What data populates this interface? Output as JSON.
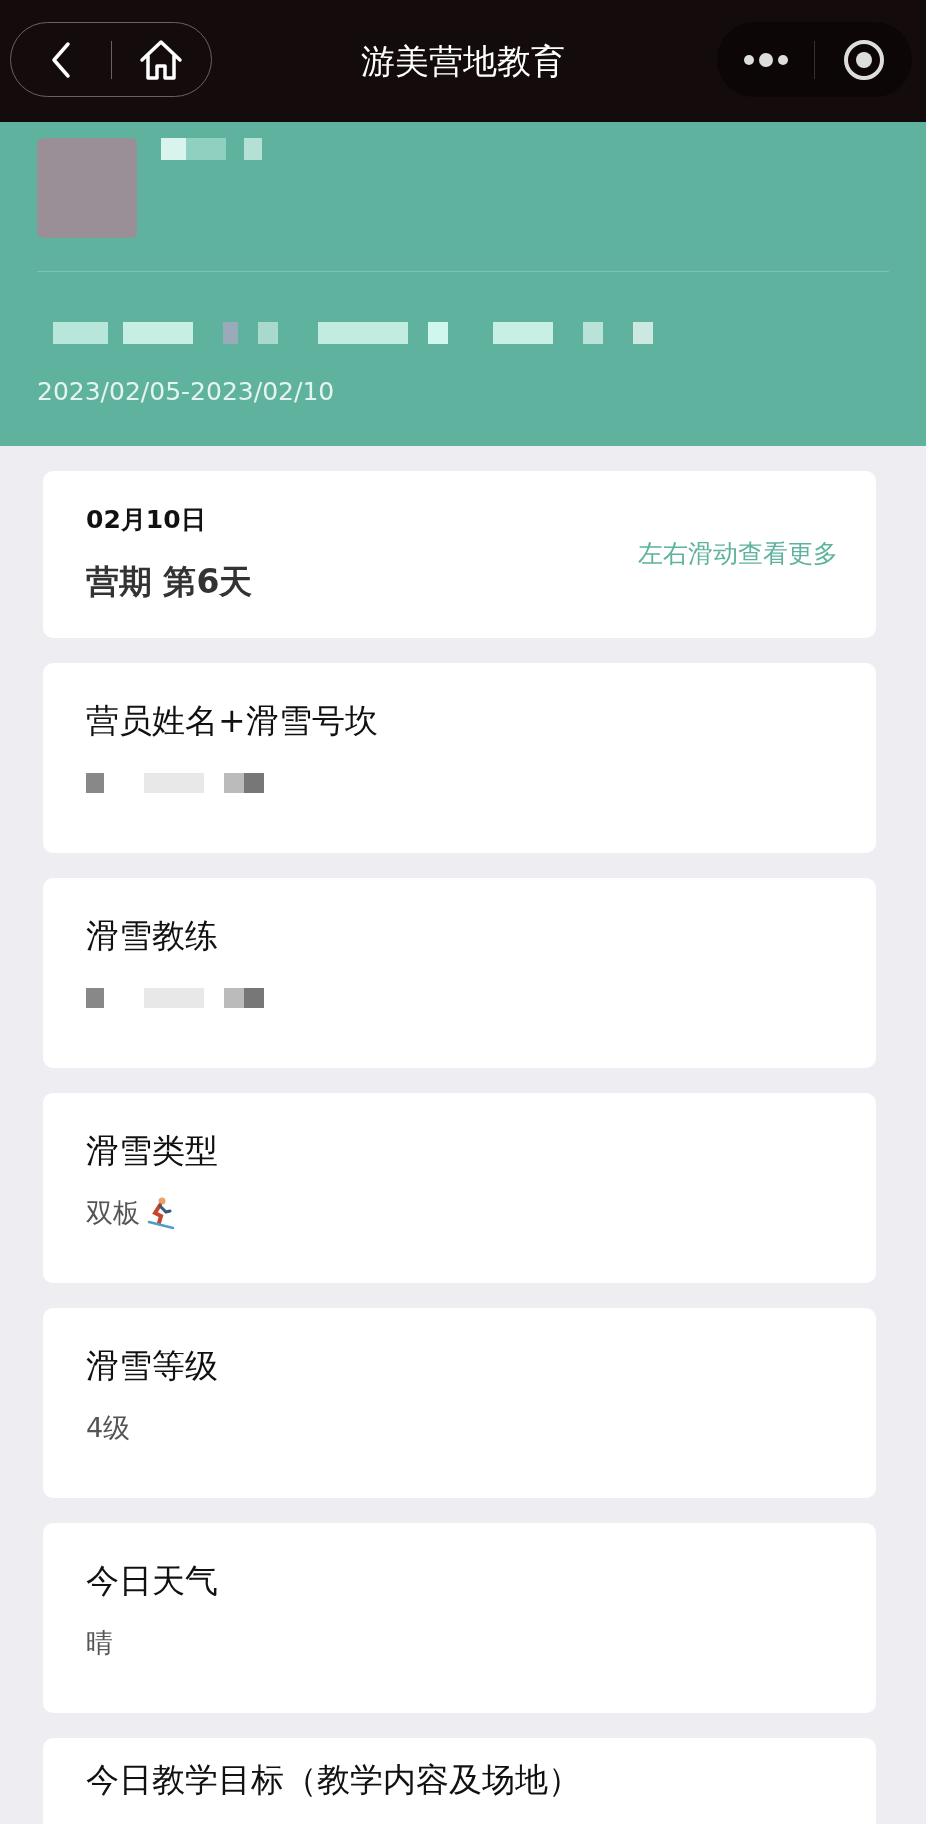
{
  "nav": {
    "title": "游美营地教育"
  },
  "header": {
    "date_range": "2023/02/05-2023/02/10"
  },
  "day_card": {
    "date": "02月10日",
    "camp_day": "营期 第6天",
    "hint": "左右滑动查看更多"
  },
  "fields": [
    {
      "kind": "redacted",
      "label": "营员姓名+滑雪号坎"
    },
    {
      "kind": "redacted",
      "label": "滑雪教练"
    },
    {
      "kind": "text_with_icon",
      "label": "滑雪类型",
      "value": "双板"
    },
    {
      "kind": "text",
      "label": "滑雪等级",
      "value": "4级"
    },
    {
      "kind": "text",
      "label": "今日天气",
      "value": "晴"
    },
    {
      "kind": "label_only",
      "label": "今日教学目标（教学内容及场地）"
    }
  ]
}
